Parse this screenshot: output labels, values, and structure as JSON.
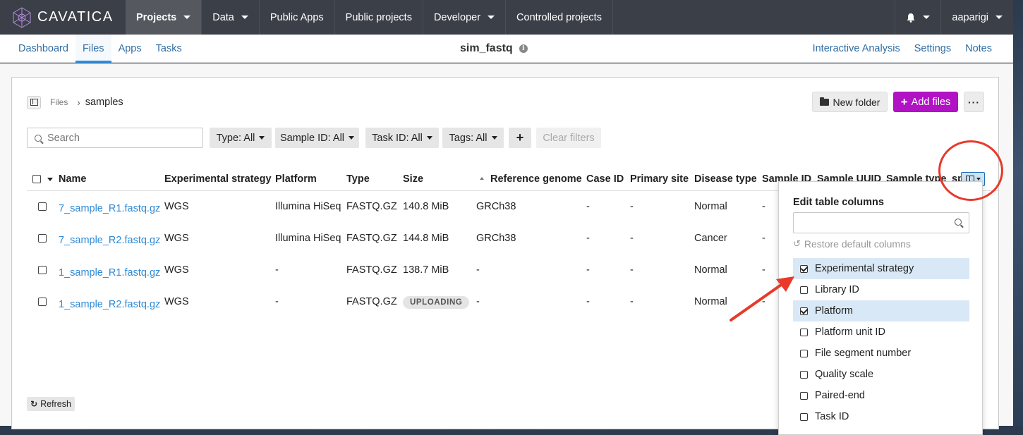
{
  "nav": {
    "logo_text": "CAVATICA",
    "items": [
      {
        "label": "Projects",
        "caret": true,
        "active": true
      },
      {
        "label": "Data",
        "caret": true
      },
      {
        "label": "Public Apps"
      },
      {
        "label": "Public projects"
      },
      {
        "label": "Developer",
        "caret": true
      },
      {
        "label": "Controlled projects"
      }
    ],
    "user": "aaparigi"
  },
  "subnav": {
    "tabs": [
      "Dashboard",
      "Files",
      "Apps",
      "Tasks"
    ],
    "active_tab": "Files",
    "project_title": "sim_fastq",
    "right_tabs": [
      "Interactive Analysis",
      "Settings",
      "Notes"
    ]
  },
  "breadcrumb": {
    "root": "Files",
    "current": "samples"
  },
  "toolbar": {
    "new_folder": "New folder",
    "add_files": "Add files",
    "more": "···"
  },
  "filters": {
    "search_placeholder": "Search",
    "type": "Type: All",
    "sample_id": "Sample ID: All",
    "task_id": "Task ID: All",
    "tags": "Tags: All",
    "add": "+",
    "clear": "Clear filters"
  },
  "table": {
    "columns": [
      "Name",
      "Experimental strategy",
      "Platform",
      "Type",
      "Size",
      "Reference genome",
      "Case ID",
      "Primary site",
      "Disease type",
      "Sample ID",
      "Sample UUID",
      "Sample type",
      "sp"
    ],
    "rows": [
      {
        "name": "7_sample_R1.fastq.gz",
        "strategy": "WGS",
        "platform": "Illumina HiSeq",
        "type": "FASTQ.GZ",
        "size": "140.8 MiB",
        "genome": "GRCh38",
        "case_id": "-",
        "primary_site": "-",
        "disease": "Normal",
        "sample_id": "-"
      },
      {
        "name": "7_sample_R2.fastq.gz",
        "strategy": "WGS",
        "platform": "Illumina HiSeq",
        "type": "FASTQ.GZ",
        "size": "144.8 MiB",
        "genome": "GRCh38",
        "case_id": "-",
        "primary_site": "-",
        "disease": "Cancer",
        "sample_id": "-"
      },
      {
        "name": "1_sample_R1.fastq.gz",
        "strategy": "WGS",
        "platform": "-",
        "type": "FASTQ.GZ",
        "size": "138.7 MiB",
        "genome": "-",
        "case_id": "-",
        "primary_site": "-",
        "disease": "Normal",
        "sample_id": "-"
      },
      {
        "name": "1_sample_R2.fastq.gz",
        "strategy": "WGS",
        "platform": "-",
        "type": "FASTQ.GZ",
        "size": "UPLOADING",
        "genome": "-",
        "case_id": "-",
        "primary_site": "-",
        "disease": "Normal",
        "sample_id": "-"
      }
    ]
  },
  "refresh": "Refresh",
  "column_editor": {
    "title": "Edit table columns",
    "restore": "Restore default columns",
    "items": [
      {
        "label": "Experimental strategy",
        "checked": true
      },
      {
        "label": "Library ID",
        "checked": false
      },
      {
        "label": "Platform",
        "checked": true
      },
      {
        "label": "Platform unit ID",
        "checked": false
      },
      {
        "label": "File segment number",
        "checked": false
      },
      {
        "label": "Quality scale",
        "checked": false
      },
      {
        "label": "Paired-end",
        "checked": false
      },
      {
        "label": "Task ID",
        "checked": false
      }
    ]
  },
  "colors": {
    "accent": "#b112c4",
    "link": "#2e89d5",
    "annotation": "#e8392a"
  }
}
